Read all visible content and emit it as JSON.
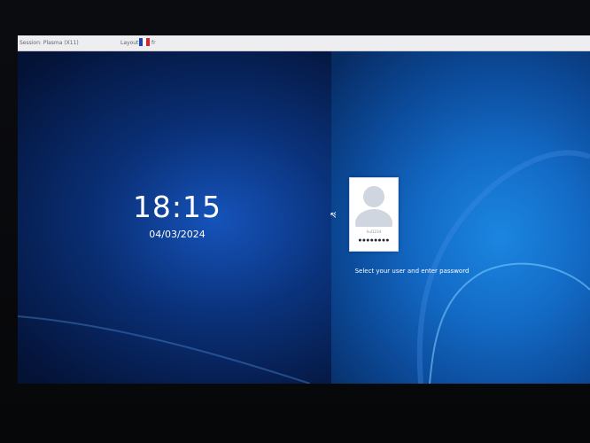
{
  "topbar": {
    "session": "Session: Plasma (X11)",
    "layout_label": "Layout",
    "layout_code": "fr",
    "flag_colors": [
      "#1f44b8",
      "#ffffff",
      "#e0212b"
    ]
  },
  "clock": {
    "time": "18:15",
    "date": "04/03/2024"
  },
  "login": {
    "user_name": "hul1234",
    "password_value": "●●●●●●●●",
    "prompt": "Select your user and enter password"
  },
  "icons": {
    "previous_user": "chevron-left-icon",
    "avatar": "user-silhouette-icon",
    "pointer": "mouse-cursor-icon"
  }
}
